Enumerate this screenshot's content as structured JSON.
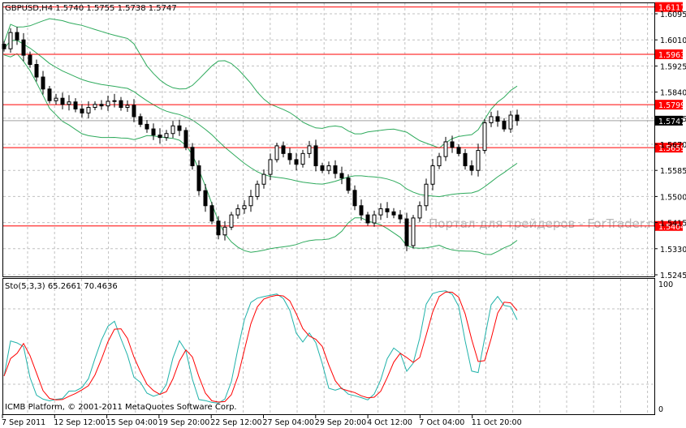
{
  "header": {
    "symbol_info": "GBPUSD,H4 1.5740 1.5755 1.5738 1.5747"
  },
  "indicator": {
    "label": "Sto(5,3,3) 65.2661 70.4636",
    "scale_top": "100",
    "scale_bottom": "0"
  },
  "copyright": "ICMB Platform, © 2001-2011 MetaQuotes Software Corp.",
  "watermark": "Портал для трейдеров - ForTrader.ru",
  "colors": {
    "background": "#ffffff",
    "candle": "#000000",
    "bollinger": "#2eaa5c",
    "hline": "#ff0000",
    "stoch_main": "#20b2aa",
    "stoch_signal": "#ff0000",
    "grid": "#c0c0c0",
    "current_price_line": "#a0a0a0"
  },
  "chart_data": {
    "type": "candlestick",
    "timeframe": "H4",
    "symbol": "GBPUSD",
    "ylim": [
      1.5245,
      1.6117
    ],
    "grid": true,
    "price_ticks": [
      "1.6095",
      "1.6010",
      "1.5925",
      "1.5840",
      "1.5755",
      "1.5670",
      "1.5585",
      "1.5500",
      "1.5415",
      "1.5330",
      "1.5245"
    ],
    "time_labels": [
      "7 Sep 2011",
      "12 Sep 12:00",
      "15 Sep 04:00",
      "19 Sep 20:00",
      "22 Sep 12:00",
      "27 Sep 04:00",
      "29 Sep 20:00",
      "4 Oct 12:00",
      "7 Oct 04:00",
      "11 Oct 20:00"
    ],
    "horizontal_levels": [
      "1.6117",
      "1.5963",
      "1.5799",
      "1.5659",
      "1.5404"
    ],
    "current_price": "1.5747",
    "closes": [
      1.5981,
      1.6034,
      1.601,
      1.596,
      1.593,
      1.5889,
      1.585,
      1.5812,
      1.582,
      1.58,
      1.5808,
      1.5785,
      1.5772,
      1.579,
      1.58,
      1.5795,
      1.581,
      1.5812,
      1.579,
      1.5797,
      1.576,
      1.5735,
      1.572,
      1.57,
      1.5692,
      1.5705,
      1.573,
      1.5715,
      1.566,
      1.56,
      1.5519,
      1.547,
      1.542,
      1.5375,
      1.54,
      1.544,
      1.546,
      1.547,
      1.55,
      1.554,
      1.5572,
      1.562,
      1.5665,
      1.564,
      1.562,
      1.5605,
      1.564,
      1.5665,
      1.56,
      1.5585,
      1.56,
      1.5575,
      1.556,
      1.552,
      1.547,
      1.544,
      1.5414,
      1.544,
      1.546,
      1.545,
      1.544,
      1.5427,
      1.534,
      1.543,
      1.547,
      1.554,
      1.56,
      1.563,
      1.5678,
      1.566,
      1.564,
      1.56,
      1.5585,
      1.565,
      1.574,
      1.576,
      1.5745,
      1.572,
      1.5765,
      1.5747
    ],
    "indicators": [
      "Bollinger Bands",
      "Stochastic(5,3,3)"
    ],
    "stochastic_last": {
      "main": 65.2661,
      "signal": 70.4636
    }
  }
}
